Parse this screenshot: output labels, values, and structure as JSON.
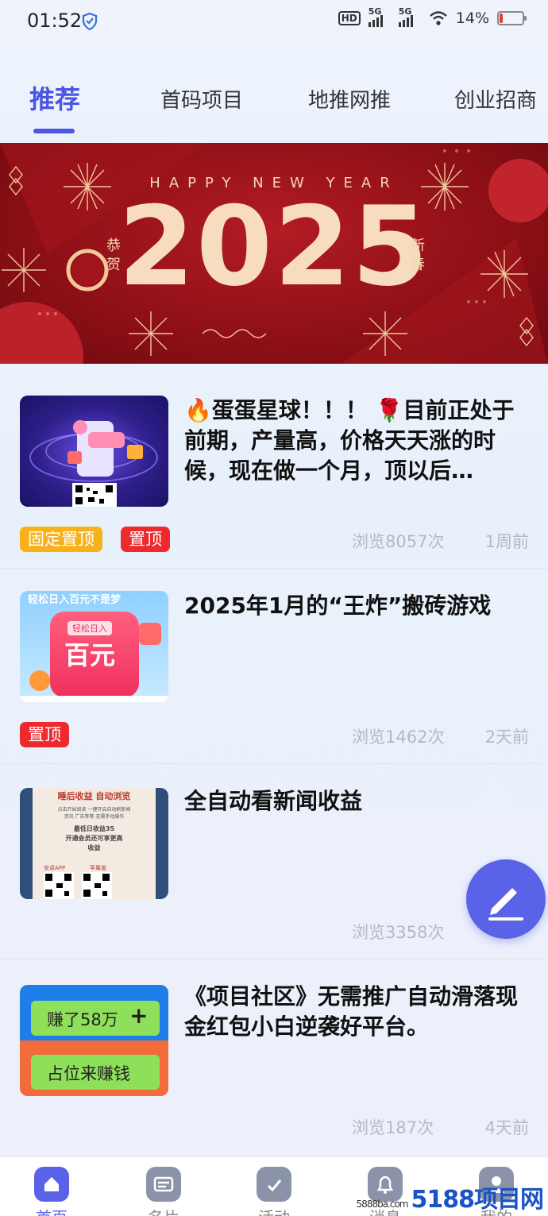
{
  "status_bar": {
    "time": "01:52",
    "battery_text": "14%",
    "battery_level": 0.14,
    "signal_1_label": "5G",
    "signal_2_label": "5G",
    "hd_label": "HD"
  },
  "tabs": [
    {
      "label": "推荐",
      "active": true
    },
    {
      "label": "首码项目",
      "active": false
    },
    {
      "label": "地推网推",
      "active": false
    },
    {
      "label": "创业招商",
      "active": false
    }
  ],
  "banner": {
    "subtitle": "HAPPY NEW YEAR",
    "year": "2025",
    "left_text": "恭贺",
    "right_text": "新春"
  },
  "feed": [
    {
      "title": "🔥蛋蛋星球！！！ 🌹目前正处于前期，产量高，价格天天涨的时候，现在做一个月，顶以后…",
      "tags": [
        "固定置顶",
        "置顶"
      ],
      "views": "浏览8057次",
      "time": "1周前"
    },
    {
      "title": "2025年1月的“王炸”搬砖游戏",
      "tags": [
        "置顶"
      ],
      "views": "浏览1462次",
      "time": "2天前",
      "thumb_top": "轻松日入百元不是梦",
      "thumb_badge": "轻松日入",
      "thumb_main": "百元"
    },
    {
      "title": "全自动看新闻收益",
      "tags": [],
      "views": "浏览3358次",
      "time": "",
      "thumb_head": "睡后收益 自动浏览",
      "thumb_l1": "点击开始阅读 一键开启自动刷新闻",
      "thumb_l2": "资讯 广告等等 无需手动操作",
      "thumb_l3": "最低日收益35",
      "thumb_l4": "开通会员还可享更高",
      "thumb_l5": "收益",
      "thumb_a": "安卓APP",
      "thumb_b": "苹果版"
    },
    {
      "title": "《项目社区》无需推广自动滑落现金红包小白逆袭好平台。",
      "tags": [],
      "views": "浏览187次",
      "time": "4天前",
      "thumb_btn1": "赚了58万",
      "thumb_btn2": "占位来赚钱"
    }
  ],
  "bottom_nav": [
    {
      "label": "首页",
      "icon": "home-icon",
      "active": true
    },
    {
      "label": "名片",
      "icon": "card-icon",
      "active": false
    },
    {
      "label": "活动",
      "icon": "task-icon",
      "active": false
    },
    {
      "label": "消息",
      "icon": "bell-icon",
      "active": false
    },
    {
      "label": "我的",
      "icon": "user-icon",
      "active": false
    }
  ],
  "watermark": {
    "domain": "5888ba.com",
    "brand": "5188项目网"
  },
  "colors": {
    "accent": "#4a56e2",
    "tag_yellow": "#f7b21a",
    "tag_red": "#ee2a2f",
    "banner_red": "#8d0f16"
  }
}
